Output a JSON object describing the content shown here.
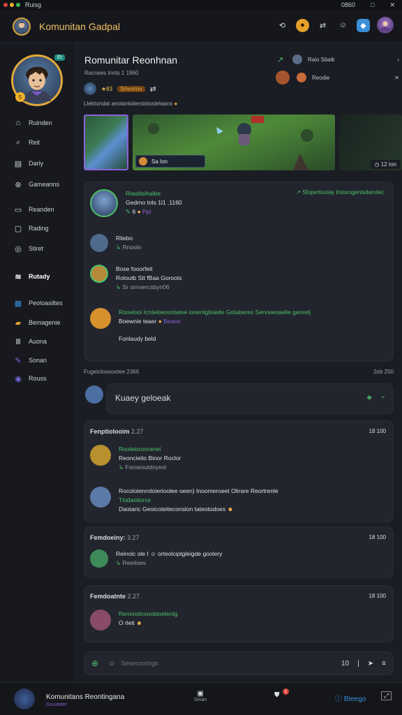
{
  "titlebar": {
    "app_name": "Ruisg",
    "controls": {
      "min": "0860",
      "restore": "□",
      "close": "✕"
    }
  },
  "header": {
    "title": "Komunitan Gadpal"
  },
  "sidebar": {
    "status_badge": "Et",
    "level_badge": "5",
    "items": [
      {
        "label": "Ruinden",
        "icon": "home-icon"
      },
      {
        "label": "Reit",
        "icon": "search-icon"
      },
      {
        "label": "Dariy",
        "icon": "calendar-icon"
      },
      {
        "label": "Gameanns",
        "icon": "gamepad-icon"
      },
      {
        "label": "Reanden",
        "icon": "book-icon"
      },
      {
        "label": "Rading",
        "icon": "chat-icon"
      },
      {
        "label": "Stiret",
        "icon": "target-icon"
      },
      {
        "label": "Rutady",
        "icon": "layers-icon"
      },
      {
        "label": "Peoloasiltes",
        "icon": "grid-icon"
      },
      {
        "label": "Bemagenie",
        "icon": "folder-icon"
      },
      {
        "label": "Auona",
        "icon": "bars-icon"
      },
      {
        "label": "Sonan",
        "icon": "brush-icon"
      },
      {
        "label": "Rouss",
        "icon": "discord-icon"
      }
    ]
  },
  "profile": {
    "name": "Romunitar Reonhnan",
    "subtitle": "Racraws tnnts 1 1960",
    "stat": "★83",
    "badge": "Srivorioo",
    "share": "⇄"
  },
  "friends": [
    {
      "label": "Raio Stiatk"
    },
    {
      "label": "Reodie"
    }
  ],
  "description": "Llebtundat anotanlolierstslostelaans",
  "gallery": {
    "caption": "Sa Ion",
    "count": "12 Ion"
  },
  "chat": {
    "main_user": {
      "title": "Rlaslitslhalbe",
      "subtitle": "Gedrno tnls 1l1 .1160",
      "right": "↗ Sfopertiuslay lrstorogenlsdamitec",
      "stat": "6",
      "status": "Ppl"
    },
    "thread": [
      {
        "name": "Rliebo",
        "text": "Rnoolo"
      },
      {
        "name": "Bose fooorfeit",
        "text": "Roloutb Stt fBaa Goroots",
        "time": "Sr ornoercsbyn06"
      },
      {
        "name": "Rooelooi Icnteloeoonlatee ionenlgtioede Gotaberes Servsieoaelle genretj",
        "text": "Boewnie teaer",
        "tag": "Beaoe",
        "footer": "Fonlaudy beld"
      }
    ],
    "divider": {
      "left": "Fugeloloesoetee 2366",
      "right": "2eb 250"
    },
    "collapse": {
      "label": "Kuaey geloeak"
    },
    "groups": [
      {
        "title": "Fenptiolooim",
        "time_left": "2.27",
        "time_right": "18 100",
        "msgs": [
          {
            "name": "Rouleiorooranet",
            "text": "Reoncieito Binor Roclor",
            "sub": "Foroeoutdoyesl"
          },
          {
            "name": "Rocoiotenroloierioolee oeen) Inoomeroeet Olirare Reortrenle",
            "sub": "Tlodaoilorcs",
            "text": "Daotaric Geoicoteiteconslon tateotodoes"
          }
        ]
      },
      {
        "title": "Femdoeiny:",
        "time_left": "3.27",
        "time_right": "18 100",
        "msgs": [
          {
            "name": "",
            "text": "Reinolc ole I ☺ orteolciptgleigde goolery",
            "sub": "Reeitoes"
          }
        ]
      },
      {
        "title": "Femdoatnte",
        "time_left": "2.27",
        "time_right": "18 100",
        "msgs": [
          {
            "name": "Renonolconobloetenlg",
            "text": "O rleit"
          }
        ]
      }
    ]
  },
  "input": {
    "placeholder": "Seneroorlrigs",
    "char_count": "10"
  },
  "bottom": {
    "title": "Komunitans Reontingana",
    "subtitle": "Gruuteerr",
    "tab1": "Sman",
    "tab2": "",
    "right_label": "Bteego",
    "badge": "1"
  },
  "colors": {
    "accent": "#f2c063",
    "green": "#4cc26b",
    "purple": "#8b62d8",
    "blue": "#3a8fd6"
  }
}
